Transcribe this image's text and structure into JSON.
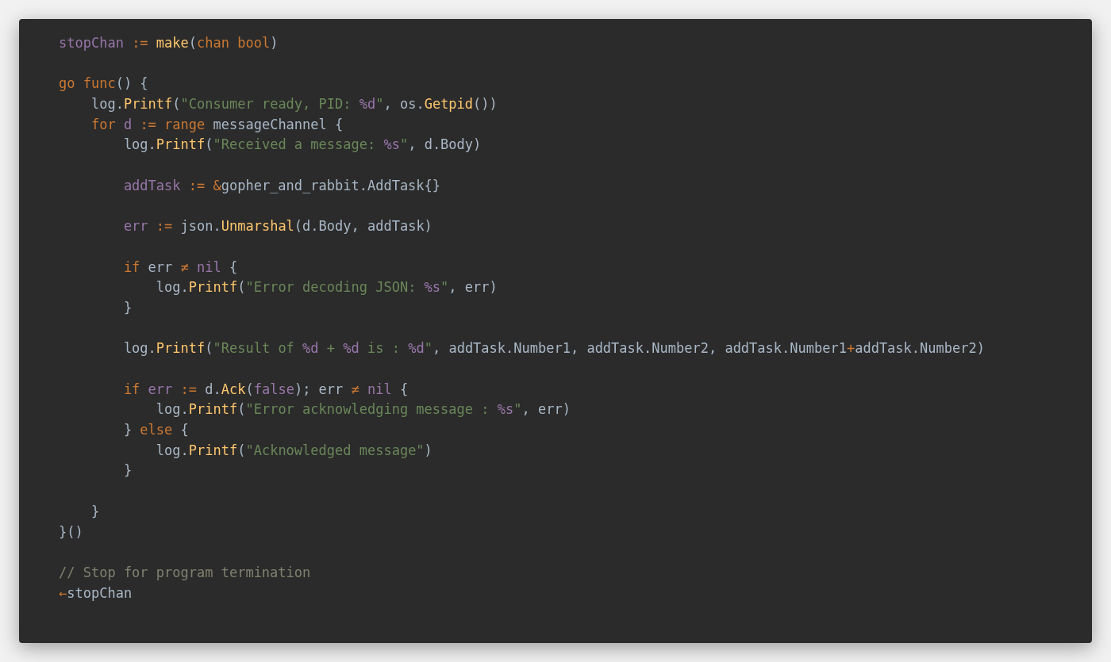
{
  "code_blocks": [
    {
      "lines": [
        {
          "tokens": [
            {
              "kind": "variable",
              "text": "stopChan "
            },
            {
              "kind": "keyword",
              "text": ":= "
            },
            {
              "kind": "function",
              "text": "make"
            },
            {
              "kind": "plain",
              "text": "("
            },
            {
              "kind": "keyword",
              "text": "chan bool"
            },
            {
              "kind": "plain",
              "text": ")"
            }
          ]
        }
      ]
    },
    {
      "lines": [
        {
          "tokens": [
            {
              "kind": "keyword",
              "text": "go func"
            },
            {
              "kind": "plain",
              "text": "() {"
            }
          ]
        },
        {
          "tokens": [
            {
              "kind": "plain",
              "text": "    log."
            },
            {
              "kind": "function",
              "text": "Printf"
            },
            {
              "kind": "plain",
              "text": "("
            },
            {
              "kind": "string",
              "text": "\"Consumer ready, PID: "
            },
            {
              "kind": "variable",
              "text": "%d"
            },
            {
              "kind": "string",
              "text": "\""
            },
            {
              "kind": "plain",
              "text": ", os."
            },
            {
              "kind": "function",
              "text": "Getpid"
            },
            {
              "kind": "plain",
              "text": "())"
            }
          ]
        },
        {
          "tokens": [
            {
              "kind": "keyword",
              "text": "    for "
            },
            {
              "kind": "variable",
              "text": "d "
            },
            {
              "kind": "keyword",
              "text": ":= range "
            },
            {
              "kind": "plain",
              "text": "messageChannel {"
            }
          ]
        },
        {
          "tokens": [
            {
              "kind": "plain",
              "text": "        log."
            },
            {
              "kind": "function",
              "text": "Printf"
            },
            {
              "kind": "plain",
              "text": "("
            },
            {
              "kind": "string",
              "text": "\"Received a message: "
            },
            {
              "kind": "variable",
              "text": "%s"
            },
            {
              "kind": "string",
              "text": "\""
            },
            {
              "kind": "plain",
              "text": ", d.Body)"
            }
          ]
        }
      ]
    },
    {
      "lines": [
        {
          "tokens": [
            {
              "kind": "variable",
              "text": "        addTask "
            },
            {
              "kind": "keyword",
              "text": ":= &"
            },
            {
              "kind": "plain",
              "text": "gopher_and_rabbit.AddTask{}"
            }
          ]
        }
      ]
    },
    {
      "lines": [
        {
          "tokens": [
            {
              "kind": "variable",
              "text": "        err "
            },
            {
              "kind": "keyword",
              "text": ":="
            },
            {
              "kind": "plain",
              "text": " json."
            },
            {
              "kind": "function",
              "text": "Unmarshal"
            },
            {
              "kind": "plain",
              "text": "(d.Body, addTask)"
            }
          ]
        }
      ]
    },
    {
      "lines": [
        {
          "tokens": [
            {
              "kind": "keyword",
              "text": "        if"
            },
            {
              "kind": "plain",
              "text": " err "
            },
            {
              "kind": "keyword",
              "text": "≠ "
            },
            {
              "kind": "variable",
              "text": "nil"
            },
            {
              "kind": "plain",
              "text": " {"
            }
          ]
        },
        {
          "tokens": [
            {
              "kind": "plain",
              "text": "            log."
            },
            {
              "kind": "function",
              "text": "Printf"
            },
            {
              "kind": "plain",
              "text": "("
            },
            {
              "kind": "string",
              "text": "\"Error decoding JSON: "
            },
            {
              "kind": "variable",
              "text": "%s"
            },
            {
              "kind": "string",
              "text": "\""
            },
            {
              "kind": "plain",
              "text": ", err)"
            }
          ]
        },
        {
          "tokens": [
            {
              "kind": "plain",
              "text": "        }"
            }
          ]
        }
      ]
    },
    {
      "lines": [
        {
          "tokens": [
            {
              "kind": "plain",
              "text": "        log."
            },
            {
              "kind": "function",
              "text": "Printf"
            },
            {
              "kind": "plain",
              "text": "("
            },
            {
              "kind": "string",
              "text": "\"Result of "
            },
            {
              "kind": "variable",
              "text": "%d"
            },
            {
              "kind": "string",
              "text": " + "
            },
            {
              "kind": "variable",
              "text": "%d"
            },
            {
              "kind": "string",
              "text": " is : "
            },
            {
              "kind": "variable",
              "text": "%d"
            },
            {
              "kind": "string",
              "text": "\""
            },
            {
              "kind": "plain",
              "text": ", addTask.Number1, addTask.Number2, addTask.Number1"
            },
            {
              "kind": "keyword",
              "text": "+"
            },
            {
              "kind": "plain",
              "text": "addTask.Number2)"
            }
          ]
        }
      ]
    },
    {
      "lines": [
        {
          "tokens": [
            {
              "kind": "keyword",
              "text": "        if "
            },
            {
              "kind": "variable",
              "text": "err "
            },
            {
              "kind": "keyword",
              "text": ":="
            },
            {
              "kind": "plain",
              "text": " d."
            },
            {
              "kind": "function",
              "text": "Ack"
            },
            {
              "kind": "plain",
              "text": "("
            },
            {
              "kind": "variable",
              "text": "false"
            },
            {
              "kind": "plain",
              "text": "); err "
            },
            {
              "kind": "keyword",
              "text": "≠ "
            },
            {
              "kind": "variable",
              "text": "nil"
            },
            {
              "kind": "plain",
              "text": " {"
            }
          ]
        },
        {
          "tokens": [
            {
              "kind": "plain",
              "text": "            log."
            },
            {
              "kind": "function",
              "text": "Printf"
            },
            {
              "kind": "plain",
              "text": "("
            },
            {
              "kind": "string",
              "text": "\"Error acknowledging message : "
            },
            {
              "kind": "variable",
              "text": "%s"
            },
            {
              "kind": "string",
              "text": "\""
            },
            {
              "kind": "plain",
              "text": ", err)"
            }
          ]
        },
        {
          "tokens": [
            {
              "kind": "plain",
              "text": "        } "
            },
            {
              "kind": "keyword",
              "text": "else"
            },
            {
              "kind": "plain",
              "text": " {"
            }
          ]
        },
        {
          "tokens": [
            {
              "kind": "plain",
              "text": "            log."
            },
            {
              "kind": "function",
              "text": "Printf"
            },
            {
              "kind": "plain",
              "text": "("
            },
            {
              "kind": "string",
              "text": "\"Acknowledged message\""
            },
            {
              "kind": "plain",
              "text": ")"
            }
          ]
        },
        {
          "tokens": [
            {
              "kind": "plain",
              "text": "        }"
            }
          ]
        }
      ]
    },
    {
      "lines": [
        {
          "tokens": [
            {
              "kind": "plain",
              "text": "    }"
            }
          ]
        },
        {
          "tokens": [
            {
              "kind": "plain",
              "text": "}()"
            }
          ]
        }
      ]
    },
    {
      "lines": [
        {
          "tokens": [
            {
              "kind": "comment",
              "text": "// Stop for program termination"
            }
          ]
        },
        {
          "tokens": [
            {
              "kind": "keyword",
              "text": "←"
            },
            {
              "kind": "plain",
              "text": "stopChan"
            }
          ]
        }
      ]
    }
  ]
}
